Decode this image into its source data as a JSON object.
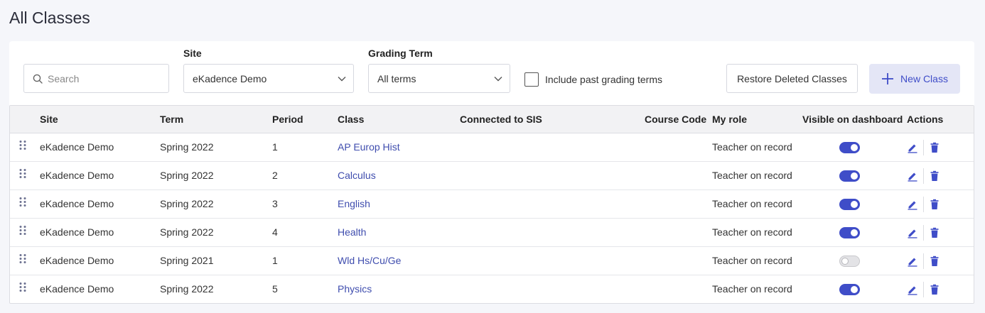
{
  "page_title": "All Classes",
  "filters": {
    "search_placeholder": "Search",
    "site_label": "Site",
    "site_value": "eKadence Demo",
    "term_label": "Grading Term",
    "term_value": "All terms",
    "include_past_label": "Include past grading terms",
    "include_past_checked": false
  },
  "actions": {
    "restore_label": "Restore Deleted Classes",
    "new_class_label": "New Class"
  },
  "colors": {
    "accent": "#3f4dc8",
    "link": "#3f4dae"
  },
  "table": {
    "columns": [
      "Site",
      "Term",
      "Period",
      "Class",
      "Connected to SIS",
      "Course Code",
      "My role",
      "Visible on dashboard",
      "Actions"
    ],
    "rows": [
      {
        "site": "eKadence Demo",
        "term": "Spring 2022",
        "period": "1",
        "class": "AP Europ Hist",
        "sis": "",
        "course_code": "",
        "role": "Teacher on record",
        "visible": true
      },
      {
        "site": "eKadence Demo",
        "term": "Spring 2022",
        "period": "2",
        "class": "Calculus",
        "sis": "",
        "course_code": "",
        "role": "Teacher on record",
        "visible": true
      },
      {
        "site": "eKadence Demo",
        "term": "Spring 2022",
        "period": "3",
        "class": "English",
        "sis": "",
        "course_code": "",
        "role": "Teacher on record",
        "visible": true
      },
      {
        "site": "eKadence Demo",
        "term": "Spring 2022",
        "period": "4",
        "class": "Health",
        "sis": "",
        "course_code": "",
        "role": "Teacher on record",
        "visible": true
      },
      {
        "site": "eKadence Demo",
        "term": "Spring 2021",
        "period": "1",
        "class": "Wld Hs/Cu/Ge",
        "sis": "",
        "course_code": "",
        "role": "Teacher on record",
        "visible": false
      },
      {
        "site": "eKadence Demo",
        "term": "Spring 2022",
        "period": "5",
        "class": "Physics",
        "sis": "",
        "course_code": "",
        "role": "Teacher on record",
        "visible": true
      }
    ]
  },
  "icons": {
    "search": "search-icon",
    "chevron": "chevron-down-icon",
    "plus": "plus-icon",
    "drag": "drag-handle-icon",
    "edit": "pencil-icon",
    "delete": "trash-icon"
  }
}
